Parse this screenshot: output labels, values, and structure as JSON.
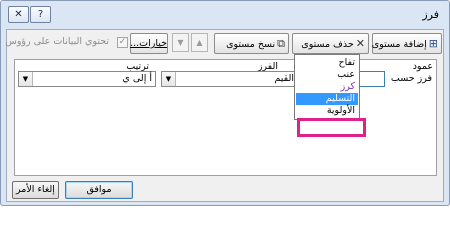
{
  "window": {
    "title": "فرز",
    "help_symbol": "?",
    "close_symbol": "✕"
  },
  "toolbar": {
    "add_level": "إضافة مستوى",
    "delete_level": "حذف مستوى",
    "copy_level": "نسخ مستوى",
    "options": "خيارات...",
    "move_up_symbol": "▲",
    "move_down_symbol": "▼",
    "headers_checkbox_label": "تحتوي البيانات على رؤوس",
    "headers_checked": true
  },
  "grid": {
    "columns": {
      "column": "عمود",
      "sort_on": "الفرز",
      "order": "ترتيب"
    },
    "rows": [
      {
        "label": "فرز حسب",
        "column_value": "",
        "sort_on_value": "القيم",
        "order_value": "أ إلى ي"
      }
    ]
  },
  "dropdown": {
    "items": [
      "تفاح",
      "عنب",
      "كرز",
      "التسليم",
      "الأولوية"
    ],
    "highlighted_index": 3
  },
  "footer": {
    "ok": "موافق",
    "cancel": "إلغاء الأمر"
  },
  "colors": {
    "highlight_frame": "#e0218a",
    "selection": "#3399ff"
  }
}
